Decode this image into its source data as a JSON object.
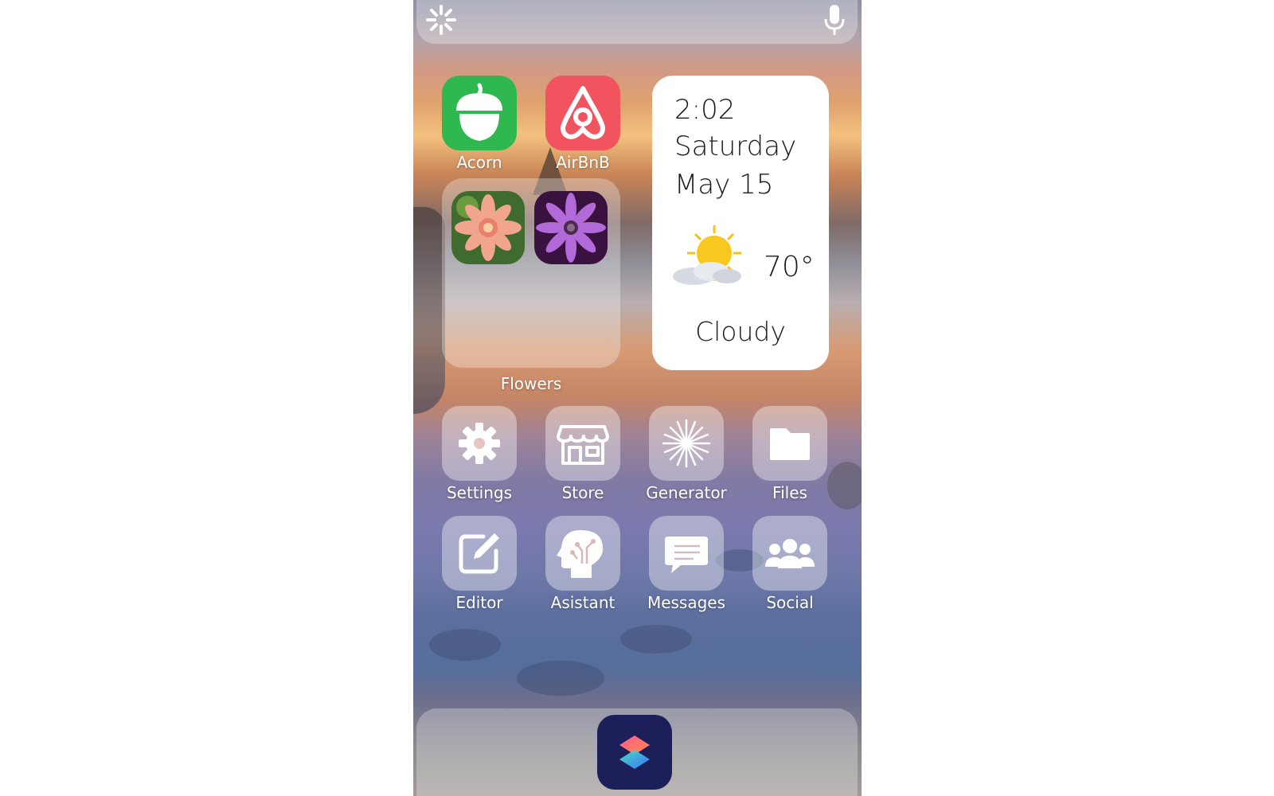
{
  "top_bar": {
    "left_icon": "sparkle-icon",
    "right_icon": "microphone-icon"
  },
  "apps_top": [
    {
      "label": "Acorn",
      "icon": "acorn-icon",
      "color": "#2fb84f"
    },
    {
      "label": "AirBnB",
      "icon": "airbnb-icon",
      "color": "#f1535f"
    }
  ],
  "folder": {
    "label": "Flowers",
    "apps": [
      {
        "icon": "dahlia-flower-icon"
      },
      {
        "icon": "purple-daisy-icon"
      }
    ]
  },
  "widget": {
    "time": "2:02",
    "day": "Saturday",
    "date": "May 15",
    "weather_icon": "sun-cloud-icon",
    "temperature": "70°",
    "condition": "Cloudy"
  },
  "apps_row1": [
    {
      "label": "Settings",
      "icon": "gear-icon"
    },
    {
      "label": "Store",
      "icon": "storefront-icon"
    },
    {
      "label": "Generator",
      "icon": "starburst-icon"
    },
    {
      "label": "Files",
      "icon": "folder-icon"
    }
  ],
  "apps_row2": [
    {
      "label": "Editor",
      "icon": "edit-pencil-icon"
    },
    {
      "label": "Asistant",
      "icon": "ai-head-icon"
    },
    {
      "label": "Messages",
      "icon": "message-bubble-icon"
    },
    {
      "label": "Social",
      "icon": "people-group-icon"
    }
  ],
  "dock": {
    "apps": [
      {
        "icon": "shortcuts-icon"
      }
    ]
  }
}
